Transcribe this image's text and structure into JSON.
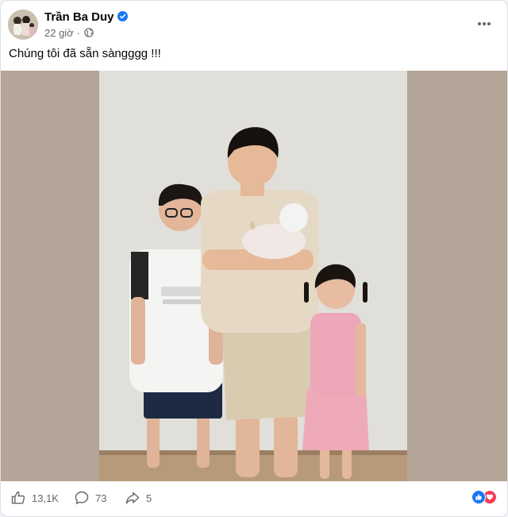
{
  "post": {
    "author_name": "Trần Ba Duy",
    "timestamp": "22 giờ",
    "separator": "·",
    "more_icon": "more-horizontal-icon",
    "caption": "Chúng tôi đã sẵn sàngggg !!!"
  },
  "actions": {
    "like_count": "13,1K",
    "comment_count": "73",
    "share_count": "5"
  },
  "colors": {
    "verified_blue": "#1877f2",
    "like_blue": "#1877f2",
    "love_red": "#f33e58",
    "text_secondary": "#65676b"
  }
}
